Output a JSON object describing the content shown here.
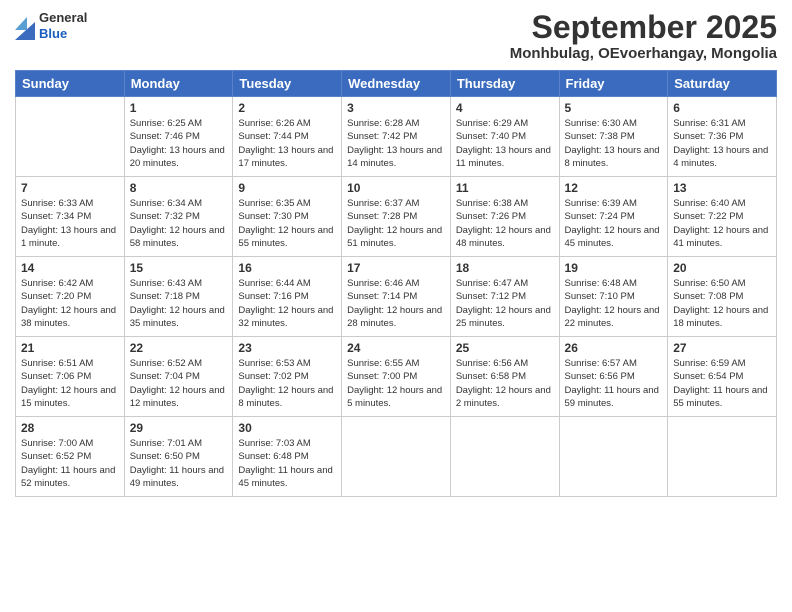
{
  "logo": {
    "general": "General",
    "blue": "Blue"
  },
  "header": {
    "month": "September 2025",
    "location": "Monhbulag, OEvoerhangay, Mongolia"
  },
  "weekdays": [
    "Sunday",
    "Monday",
    "Tuesday",
    "Wednesday",
    "Thursday",
    "Friday",
    "Saturday"
  ],
  "weeks": [
    [
      {
        "day": "",
        "sunrise": "",
        "sunset": "",
        "daylight": ""
      },
      {
        "day": "1",
        "sunrise": "Sunrise: 6:25 AM",
        "sunset": "Sunset: 7:46 PM",
        "daylight": "Daylight: 13 hours and 20 minutes."
      },
      {
        "day": "2",
        "sunrise": "Sunrise: 6:26 AM",
        "sunset": "Sunset: 7:44 PM",
        "daylight": "Daylight: 13 hours and 17 minutes."
      },
      {
        "day": "3",
        "sunrise": "Sunrise: 6:28 AM",
        "sunset": "Sunset: 7:42 PM",
        "daylight": "Daylight: 13 hours and 14 minutes."
      },
      {
        "day": "4",
        "sunrise": "Sunrise: 6:29 AM",
        "sunset": "Sunset: 7:40 PM",
        "daylight": "Daylight: 13 hours and 11 minutes."
      },
      {
        "day": "5",
        "sunrise": "Sunrise: 6:30 AM",
        "sunset": "Sunset: 7:38 PM",
        "daylight": "Daylight: 13 hours and 8 minutes."
      },
      {
        "day": "6",
        "sunrise": "Sunrise: 6:31 AM",
        "sunset": "Sunset: 7:36 PM",
        "daylight": "Daylight: 13 hours and 4 minutes."
      }
    ],
    [
      {
        "day": "7",
        "sunrise": "Sunrise: 6:33 AM",
        "sunset": "Sunset: 7:34 PM",
        "daylight": "Daylight: 13 hours and 1 minute."
      },
      {
        "day": "8",
        "sunrise": "Sunrise: 6:34 AM",
        "sunset": "Sunset: 7:32 PM",
        "daylight": "Daylight: 12 hours and 58 minutes."
      },
      {
        "day": "9",
        "sunrise": "Sunrise: 6:35 AM",
        "sunset": "Sunset: 7:30 PM",
        "daylight": "Daylight: 12 hours and 55 minutes."
      },
      {
        "day": "10",
        "sunrise": "Sunrise: 6:37 AM",
        "sunset": "Sunset: 7:28 PM",
        "daylight": "Daylight: 12 hours and 51 minutes."
      },
      {
        "day": "11",
        "sunrise": "Sunrise: 6:38 AM",
        "sunset": "Sunset: 7:26 PM",
        "daylight": "Daylight: 12 hours and 48 minutes."
      },
      {
        "day": "12",
        "sunrise": "Sunrise: 6:39 AM",
        "sunset": "Sunset: 7:24 PM",
        "daylight": "Daylight: 12 hours and 45 minutes."
      },
      {
        "day": "13",
        "sunrise": "Sunrise: 6:40 AM",
        "sunset": "Sunset: 7:22 PM",
        "daylight": "Daylight: 12 hours and 41 minutes."
      }
    ],
    [
      {
        "day": "14",
        "sunrise": "Sunrise: 6:42 AM",
        "sunset": "Sunset: 7:20 PM",
        "daylight": "Daylight: 12 hours and 38 minutes."
      },
      {
        "day": "15",
        "sunrise": "Sunrise: 6:43 AM",
        "sunset": "Sunset: 7:18 PM",
        "daylight": "Daylight: 12 hours and 35 minutes."
      },
      {
        "day": "16",
        "sunrise": "Sunrise: 6:44 AM",
        "sunset": "Sunset: 7:16 PM",
        "daylight": "Daylight: 12 hours and 32 minutes."
      },
      {
        "day": "17",
        "sunrise": "Sunrise: 6:46 AM",
        "sunset": "Sunset: 7:14 PM",
        "daylight": "Daylight: 12 hours and 28 minutes."
      },
      {
        "day": "18",
        "sunrise": "Sunrise: 6:47 AM",
        "sunset": "Sunset: 7:12 PM",
        "daylight": "Daylight: 12 hours and 25 minutes."
      },
      {
        "day": "19",
        "sunrise": "Sunrise: 6:48 AM",
        "sunset": "Sunset: 7:10 PM",
        "daylight": "Daylight: 12 hours and 22 minutes."
      },
      {
        "day": "20",
        "sunrise": "Sunrise: 6:50 AM",
        "sunset": "Sunset: 7:08 PM",
        "daylight": "Daylight: 12 hours and 18 minutes."
      }
    ],
    [
      {
        "day": "21",
        "sunrise": "Sunrise: 6:51 AM",
        "sunset": "Sunset: 7:06 PM",
        "daylight": "Daylight: 12 hours and 15 minutes."
      },
      {
        "day": "22",
        "sunrise": "Sunrise: 6:52 AM",
        "sunset": "Sunset: 7:04 PM",
        "daylight": "Daylight: 12 hours and 12 minutes."
      },
      {
        "day": "23",
        "sunrise": "Sunrise: 6:53 AM",
        "sunset": "Sunset: 7:02 PM",
        "daylight": "Daylight: 12 hours and 8 minutes."
      },
      {
        "day": "24",
        "sunrise": "Sunrise: 6:55 AM",
        "sunset": "Sunset: 7:00 PM",
        "daylight": "Daylight: 12 hours and 5 minutes."
      },
      {
        "day": "25",
        "sunrise": "Sunrise: 6:56 AM",
        "sunset": "Sunset: 6:58 PM",
        "daylight": "Daylight: 12 hours and 2 minutes."
      },
      {
        "day": "26",
        "sunrise": "Sunrise: 6:57 AM",
        "sunset": "Sunset: 6:56 PM",
        "daylight": "Daylight: 11 hours and 59 minutes."
      },
      {
        "day": "27",
        "sunrise": "Sunrise: 6:59 AM",
        "sunset": "Sunset: 6:54 PM",
        "daylight": "Daylight: 11 hours and 55 minutes."
      }
    ],
    [
      {
        "day": "28",
        "sunrise": "Sunrise: 7:00 AM",
        "sunset": "Sunset: 6:52 PM",
        "daylight": "Daylight: 11 hours and 52 minutes."
      },
      {
        "day": "29",
        "sunrise": "Sunrise: 7:01 AM",
        "sunset": "Sunset: 6:50 PM",
        "daylight": "Daylight: 11 hours and 49 minutes."
      },
      {
        "day": "30",
        "sunrise": "Sunrise: 7:03 AM",
        "sunset": "Sunset: 6:48 PM",
        "daylight": "Daylight: 11 hours and 45 minutes."
      },
      {
        "day": "",
        "sunrise": "",
        "sunset": "",
        "daylight": ""
      },
      {
        "day": "",
        "sunrise": "",
        "sunset": "",
        "daylight": ""
      },
      {
        "day": "",
        "sunrise": "",
        "sunset": "",
        "daylight": ""
      },
      {
        "day": "",
        "sunrise": "",
        "sunset": "",
        "daylight": ""
      }
    ]
  ]
}
